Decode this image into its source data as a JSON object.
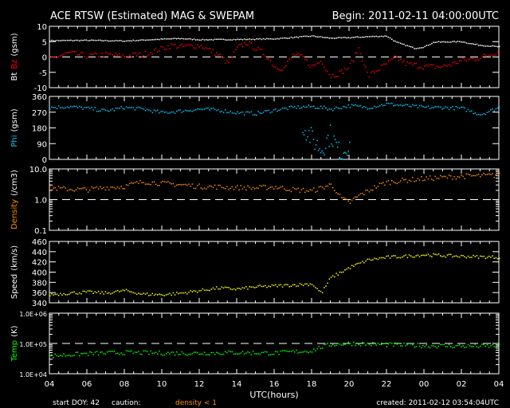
{
  "title": "ACE RTSW (Estimated) MAG & SWEPAM",
  "begin": "Begin: 2011-02-11 04:00:00UTC",
  "footer": {
    "start_doy": "start DOY:  42",
    "caution": "caution:",
    "caution_note": "density < 1",
    "created": "created: 2011-02-12 03:54:04UTC"
  },
  "colors": {
    "bt": "#ffffff",
    "bz": "#ff0000",
    "phi": "#00c8ff",
    "density": "#ff8c00",
    "speed": "#ffff00",
    "temp": "#00ff00",
    "axis": "#ffffff"
  },
  "chart_data": {
    "type": "scatter",
    "xlabel": "UTC(hours)",
    "x_tick_labels": [
      "04",
      "06",
      "08",
      "10",
      "12",
      "14",
      "16",
      "18",
      "20",
      "22",
      "00",
      "02",
      "04"
    ],
    "xlim_hours": [
      0,
      24
    ],
    "panels": [
      {
        "id": "mag",
        "ylabel_parts": [
          "Bt",
          "Bz",
          "(gsm)"
        ],
        "scale": "linear",
        "ylim": [
          -10,
          10
        ],
        "tick_labels": [
          "10",
          "5",
          "0",
          "-5",
          "-10"
        ],
        "tick_values": [
          10,
          5,
          0,
          -5,
          -10
        ],
        "dashed": 0,
        "series": [
          {
            "name": "Bt",
            "color": "#ffffff",
            "jitter": 0.15,
            "x": [
              0,
              2,
              4,
              6,
              7,
              8,
              10,
              12,
              14,
              15,
              16,
              17,
              18,
              18.5,
              19,
              19.5,
              20,
              20.5,
              22,
              22.5,
              23,
              24
            ],
            "y": [
              5.5,
              5.6,
              5.4,
              6,
              6.2,
              5.8,
              5.9,
              6.1,
              7,
              6.3,
              6.5,
              6.8,
              7,
              5,
              4,
              3,
              3.5,
              5,
              5.2,
              4.5,
              4,
              3.5
            ]
          },
          {
            "name": "Bz",
            "color": "#ff0000",
            "jitter": 0.9,
            "x": [
              0,
              1,
              2,
              3,
              4,
              5,
              6,
              6.5,
              7,
              8,
              9,
              9.5,
              10,
              10.5,
              11,
              11.5,
              12,
              12.5,
              13,
              13.5,
              14,
              14.5,
              15,
              15.5,
              16,
              16.5,
              17,
              17.5,
              18,
              18.5,
              19,
              20,
              21,
              22,
              23,
              24
            ],
            "y": [
              -0.5,
              1.5,
              0.5,
              1,
              0.5,
              1,
              3,
              4,
              3.5,
              4,
              1,
              -2,
              3,
              5,
              3,
              1,
              -3,
              -3.5,
              1,
              0,
              -3,
              -1,
              -6,
              -5,
              -3,
              3,
              -6,
              -4,
              -2,
              0,
              -2,
              -3,
              -3,
              -1,
              0,
              2
            ]
          }
        ]
      },
      {
        "id": "phi",
        "ylabel_parts": [
          "Phi",
          "(gsm)"
        ],
        "scale": "linear",
        "ylim": [
          0,
          360
        ],
        "tick_labels": [
          "360",
          "270",
          "180",
          "90",
          "0"
        ],
        "tick_values": [
          360,
          270,
          180,
          90,
          0
        ],
        "series": [
          {
            "name": "Phi",
            "color": "#00c8ff",
            "jitter": 10,
            "x": [
              0,
              1,
              2,
              3,
              4,
              5,
              6,
              7,
              8,
              9,
              10,
              11,
              12,
              13,
              14,
              14.5,
              15,
              16,
              17,
              18,
              19,
              20,
              21,
              22,
              23,
              24
            ],
            "y": [
              300,
              305,
              295,
              280,
              300,
              290,
              270,
              280,
              290,
              285,
              270,
              265,
              285,
              300,
              305,
              300,
              290,
              310,
              300,
              320,
              310,
              300,
              300,
              295,
              260,
              300
            ]
          },
          {
            "name": "Phi-scatter",
            "color": "#00c8ff",
            "jitter": 60,
            "x": [
              13.5,
              14,
              14.5,
              15,
              15.5,
              16
            ],
            "y": [
              200,
              120,
              60,
              150,
              30,
              100
            ]
          }
        ]
      },
      {
        "id": "density",
        "ylabel_parts": [
          "Density",
          "(/cm3)"
        ],
        "scale": "log",
        "ylim": [
          0.1,
          10
        ],
        "tick_labels": [
          "10.0",
          "1.0",
          "0.1"
        ],
        "tick_values": [
          10,
          1,
          0.1
        ],
        "dashed": 1,
        "series": [
          {
            "name": "Density",
            "color": "#ff8c00",
            "jitter": 0.08,
            "x": [
              0,
              1,
              2,
              3,
              4,
              5,
              6,
              7,
              8,
              9,
              10,
              11,
              12,
              13,
              14,
              14.5,
              15,
              15.5,
              16,
              17,
              18,
              19,
              20,
              22,
              24
            ],
            "y": [
              2.5,
              2.3,
              2.2,
              2.6,
              2.8,
              4,
              3.5,
              3.2,
              2.8,
              2.7,
              2.6,
              2.5,
              2.7,
              2.2,
              2.0,
              2.5,
              3.2,
              1.2,
              0.8,
              2,
              3.8,
              4.5,
              5,
              6,
              6.5
            ]
          }
        ]
      },
      {
        "id": "speed",
        "ylabel_parts": [
          "Speed",
          "(km/s)"
        ],
        "scale": "linear",
        "ylim": [
          340,
          460
        ],
        "tick_labels": [
          "460",
          "440",
          "420",
          "400",
          "380",
          "360",
          "340"
        ],
        "tick_values": [
          460,
          440,
          420,
          400,
          380,
          360,
          340
        ],
        "series": [
          {
            "name": "Speed",
            "color": "#ffff00",
            "jitter": 3,
            "x": [
              0,
              1,
              2,
              3,
              4,
              5,
              6,
              7,
              8,
              9,
              10,
              11,
              12,
              13,
              14,
              14.5,
              15,
              16,
              17,
              18,
              19,
              20,
              22,
              24
            ],
            "y": [
              357,
              360,
              362,
              360,
              365,
              358,
              357,
              360,
              365,
              370,
              368,
              372,
              374,
              376,
              378,
              360,
              390,
              410,
              425,
              430,
              432,
              435,
              432,
              430
            ]
          }
        ]
      },
      {
        "id": "temp",
        "ylabel_parts": [
          "Temp",
          "(K)"
        ],
        "scale": "log",
        "ylim": [
          10000,
          1000000
        ],
        "tick_labels": [
          "1.0E+06",
          "1.0E+05",
          "1.0E+04"
        ],
        "tick_values": [
          1000000,
          100000,
          10000
        ],
        "dashed": 100000,
        "series": [
          {
            "name": "Temp",
            "color": "#00ff00",
            "jitter": 0.07,
            "x": [
              0,
              2,
              4,
              6,
              8,
              10,
              12,
              14,
              14.5,
              15,
              16,
              18,
              20,
              22,
              24
            ],
            "y": [
              40000,
              48000,
              52000,
              50000,
              50000,
              52000,
              50000,
              60000,
              80000,
              95000,
              105000,
              95000,
              88000,
              85000,
              85000
            ]
          }
        ]
      }
    ]
  }
}
